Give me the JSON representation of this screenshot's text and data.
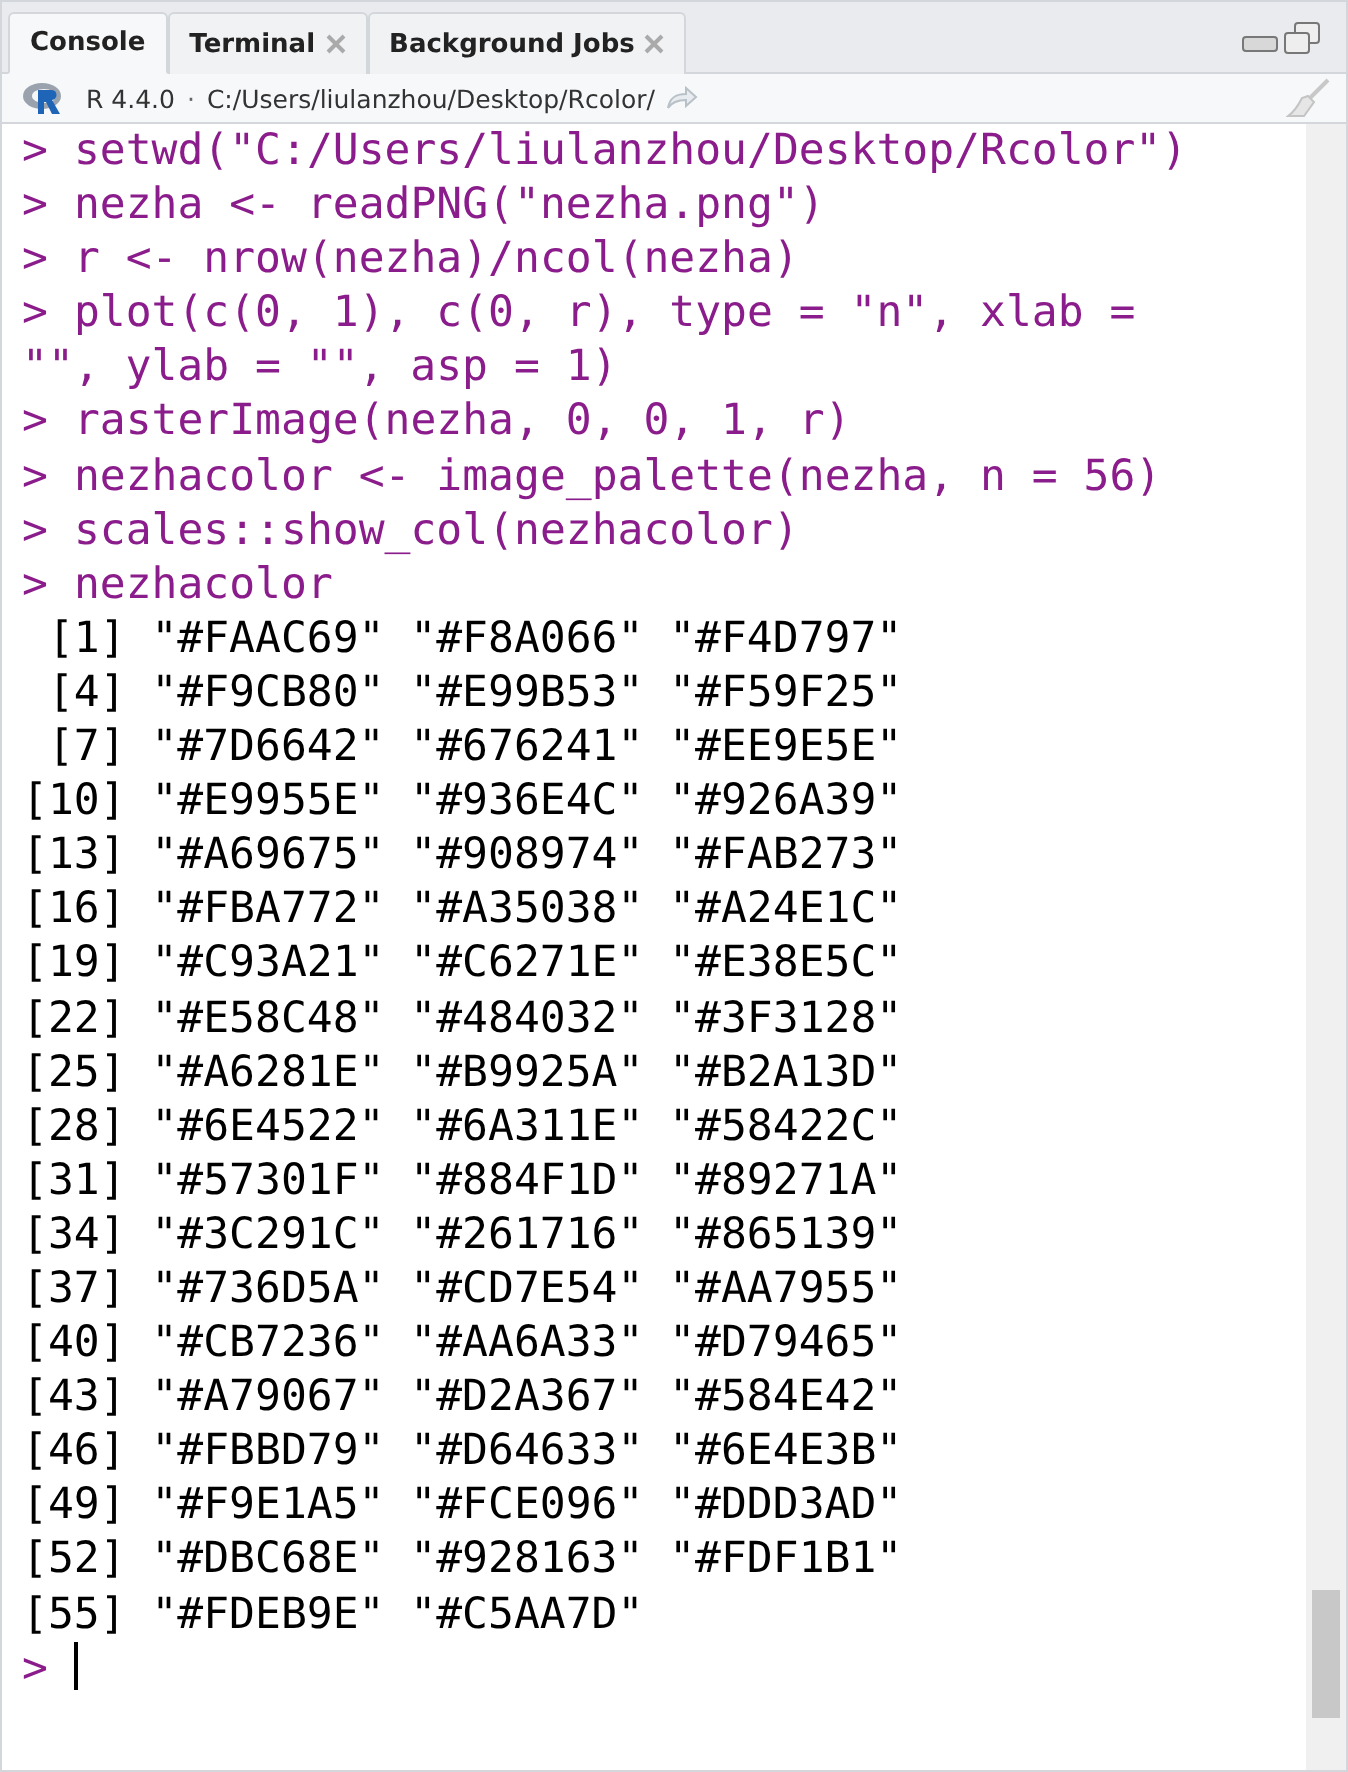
{
  "tabs": [
    {
      "label": "Console",
      "selected": true,
      "closable": false
    },
    {
      "label": "Terminal",
      "selected": false,
      "closable": true
    },
    {
      "label": "Background Jobs",
      "selected": false,
      "closable": true
    }
  ],
  "path_bar": {
    "version": "R 4.4.0",
    "separator": "·",
    "path": "C:/Users/liulanzhou/Desktop/Rcolor/"
  },
  "console": {
    "prompt": ">",
    "lines": [
      {
        "kind": "input",
        "text": "setwd(\"C:/Users/liulanzhou/Desktop/Rcolor\")"
      },
      {
        "kind": "input",
        "text": "nezha <- readPNG(\"nezha.png\")"
      },
      {
        "kind": "input",
        "text": "r <- nrow(nezha)/ncol(nezha)"
      },
      {
        "kind": "input",
        "text": "plot(c(0, 1), c(0, r), type = \"n\", xlab ="
      },
      {
        "kind": "continuation",
        "text": "\"\", ylab = \"\", asp = 1)"
      },
      {
        "kind": "input",
        "text": "rasterImage(nezha, 0, 0, 1, r)"
      },
      {
        "kind": "input",
        "text": "nezhacolor <- image_palette(nezha, n = 56)"
      },
      {
        "kind": "input",
        "text": "scales::show_col(nezhacolor)"
      },
      {
        "kind": "input",
        "text": "nezhacolor"
      },
      {
        "kind": "output",
        "text": " [1] \"#FAAC69\" \"#F8A066\" \"#F4D797\""
      },
      {
        "kind": "output",
        "text": " [4] \"#F9CB80\" \"#E99B53\" \"#F59F25\""
      },
      {
        "kind": "output",
        "text": " [7] \"#7D6642\" \"#676241\" \"#EE9E5E\""
      },
      {
        "kind": "output",
        "text": "[10] \"#E9955E\" \"#936E4C\" \"#926A39\""
      },
      {
        "kind": "output",
        "text": "[13] \"#A69675\" \"#908974\" \"#FAB273\""
      },
      {
        "kind": "output",
        "text": "[16] \"#FBA772\" \"#A35038\" \"#A24E1C\""
      },
      {
        "kind": "output",
        "text": "[19] \"#C93A21\" \"#C6271E\" \"#E38E5C\""
      },
      {
        "kind": "output",
        "text": "[22] \"#E58C48\" \"#484032\" \"#3F3128\""
      },
      {
        "kind": "output",
        "text": "[25] \"#A6281E\" \"#B9925A\" \"#B2A13D\""
      },
      {
        "kind": "output",
        "text": "[28] \"#6E4522\" \"#6A311E\" \"#58422C\""
      },
      {
        "kind": "output",
        "text": "[31] \"#57301F\" \"#884F1D\" \"#89271A\""
      },
      {
        "kind": "output",
        "text": "[34] \"#3C291C\" \"#261716\" \"#865139\""
      },
      {
        "kind": "output",
        "text": "[37] \"#736D5A\" \"#CD7E54\" \"#AA7955\""
      },
      {
        "kind": "output",
        "text": "[40] \"#CB7236\" \"#AA6A33\" \"#D79465\""
      },
      {
        "kind": "output",
        "text": "[43] \"#A79067\" \"#D2A367\" \"#584E42\""
      },
      {
        "kind": "output",
        "text": "[46] \"#FBBD79\" \"#D64633\" \"#6E4E3B\""
      },
      {
        "kind": "output",
        "text": "[49] \"#F9E1A5\" \"#FCE096\" \"#DDD3AD\""
      },
      {
        "kind": "output",
        "text": "[52] \"#DBC68E\" \"#928163\" \"#FDF1B1\""
      },
      {
        "kind": "output",
        "text": "[55] \"#FDEB9E\" \"#C5AA7D\""
      }
    ]
  }
}
